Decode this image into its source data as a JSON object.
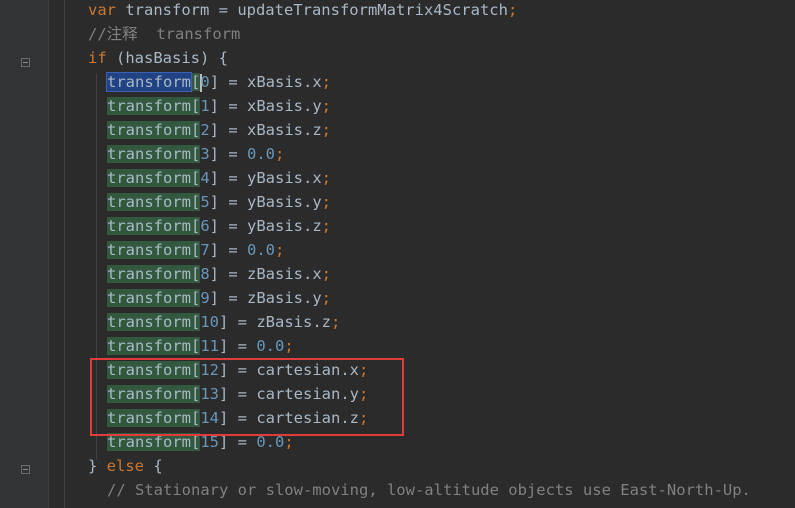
{
  "editor": {
    "lines": [
      {
        "id": "l0",
        "tokens": [
          {
            "text": "var",
            "cls": "kw"
          },
          {
            "text": " transform = updateTransformMatrix4Scratch",
            "cls": "id"
          },
          {
            "text": ";",
            "cls": "punc"
          }
        ]
      },
      {
        "id": "l1",
        "tokens": [
          {
            "text": "//注释  transform",
            "cls": "cm"
          }
        ]
      },
      {
        "id": "l2",
        "tokens": [
          {
            "text": "if",
            "cls": "kw"
          },
          {
            "text": " (hasBasis) {",
            "cls": "id"
          }
        ]
      },
      {
        "id": "l3",
        "tokens": [
          {
            "text": "transform",
            "cls": "hl-sel"
          },
          {
            "text": "[",
            "cls": "hl"
          },
          {
            "text": "0",
            "cls": "num",
            "caret": true
          },
          {
            "text": "] = xBasis.x",
            "cls": "id"
          },
          {
            "text": ";",
            "cls": "punc"
          }
        ]
      },
      {
        "id": "l4",
        "tokens": [
          {
            "text": "transform[",
            "cls": "hl"
          },
          {
            "text": "1",
            "cls": "num"
          },
          {
            "text": "] = xBasis.y",
            "cls": "id"
          },
          {
            "text": ";",
            "cls": "punc"
          }
        ]
      },
      {
        "id": "l5",
        "tokens": [
          {
            "text": "transform[",
            "cls": "hl"
          },
          {
            "text": "2",
            "cls": "num"
          },
          {
            "text": "] = xBasis.z",
            "cls": "id"
          },
          {
            "text": ";",
            "cls": "punc"
          }
        ]
      },
      {
        "id": "l6",
        "tokens": [
          {
            "text": "transform[",
            "cls": "hl"
          },
          {
            "text": "3",
            "cls": "num"
          },
          {
            "text": "] = ",
            "cls": "id"
          },
          {
            "text": "0.0",
            "cls": "num"
          },
          {
            "text": ";",
            "cls": "punc"
          }
        ]
      },
      {
        "id": "l7",
        "tokens": [
          {
            "text": "transform[",
            "cls": "hl"
          },
          {
            "text": "4",
            "cls": "num"
          },
          {
            "text": "] = yBasis.x",
            "cls": "id"
          },
          {
            "text": ";",
            "cls": "punc"
          }
        ]
      },
      {
        "id": "l8",
        "tokens": [
          {
            "text": "transform[",
            "cls": "hl"
          },
          {
            "text": "5",
            "cls": "num"
          },
          {
            "text": "] = yBasis.y",
            "cls": "id"
          },
          {
            "text": ";",
            "cls": "punc"
          }
        ]
      },
      {
        "id": "l9",
        "tokens": [
          {
            "text": "transform[",
            "cls": "hl"
          },
          {
            "text": "6",
            "cls": "num"
          },
          {
            "text": "] = yBasis.z",
            "cls": "id"
          },
          {
            "text": ";",
            "cls": "punc"
          }
        ]
      },
      {
        "id": "l10",
        "tokens": [
          {
            "text": "transform[",
            "cls": "hl"
          },
          {
            "text": "7",
            "cls": "num"
          },
          {
            "text": "] = ",
            "cls": "id"
          },
          {
            "text": "0.0",
            "cls": "num"
          },
          {
            "text": ";",
            "cls": "punc"
          }
        ]
      },
      {
        "id": "l11",
        "tokens": [
          {
            "text": "transform[",
            "cls": "hl"
          },
          {
            "text": "8",
            "cls": "num"
          },
          {
            "text": "] = zBasis.x",
            "cls": "id"
          },
          {
            "text": ";",
            "cls": "punc"
          }
        ]
      },
      {
        "id": "l12",
        "tokens": [
          {
            "text": "transform[",
            "cls": "hl"
          },
          {
            "text": "9",
            "cls": "num"
          },
          {
            "text": "] = zBasis.y",
            "cls": "id"
          },
          {
            "text": ";",
            "cls": "punc"
          }
        ]
      },
      {
        "id": "l13",
        "tokens": [
          {
            "text": "transform[",
            "cls": "hl"
          },
          {
            "text": "10",
            "cls": "num"
          },
          {
            "text": "] = zBasis.z",
            "cls": "id"
          },
          {
            "text": ";",
            "cls": "punc"
          }
        ]
      },
      {
        "id": "l14",
        "tokens": [
          {
            "text": "transform[",
            "cls": "hl"
          },
          {
            "text": "11",
            "cls": "num"
          },
          {
            "text": "] = ",
            "cls": "id"
          },
          {
            "text": "0.0",
            "cls": "num"
          },
          {
            "text": ";",
            "cls": "punc"
          }
        ]
      },
      {
        "id": "l15",
        "tokens": [
          {
            "text": "transform[",
            "cls": "hl"
          },
          {
            "text": "12",
            "cls": "num"
          },
          {
            "text": "] = cartesian.x",
            "cls": "id"
          },
          {
            "text": ";",
            "cls": "punc"
          }
        ]
      },
      {
        "id": "l16",
        "tokens": [
          {
            "text": "transform[",
            "cls": "hl"
          },
          {
            "text": "13",
            "cls": "num"
          },
          {
            "text": "] = cartesian.y",
            "cls": "id"
          },
          {
            "text": ";",
            "cls": "punc"
          }
        ]
      },
      {
        "id": "l17",
        "tokens": [
          {
            "text": "transform[",
            "cls": "hl"
          },
          {
            "text": "14",
            "cls": "num"
          },
          {
            "text": "] = cartesian.z",
            "cls": "id"
          },
          {
            "text": ";",
            "cls": "punc"
          }
        ]
      },
      {
        "id": "l18",
        "tokens": [
          {
            "text": "transform[",
            "cls": "hl"
          },
          {
            "text": "15",
            "cls": "num"
          },
          {
            "text": "] = ",
            "cls": "id"
          },
          {
            "text": "0.0",
            "cls": "num"
          },
          {
            "text": ";",
            "cls": "punc"
          }
        ]
      },
      {
        "id": "l19",
        "tokens": [
          {
            "text": "} ",
            "cls": "id"
          },
          {
            "text": "else",
            "cls": "kw"
          },
          {
            "text": " {",
            "cls": "id"
          }
        ]
      },
      {
        "id": "l20",
        "tokens": [
          {
            "text": "// Stationary or slow-moving, low-altitude objects use East-North-Up.",
            "cls": "cm"
          }
        ]
      }
    ]
  },
  "colors": {
    "background": "#2b2b2b",
    "gutter": "#313335",
    "keyword": "#cc7832",
    "number": "#6897bb",
    "comment": "#808080",
    "identifier": "#a9b7c6",
    "usage_highlight": "#32593d",
    "selection_highlight": "#214283",
    "annotation_box": "#e03c3c"
  }
}
